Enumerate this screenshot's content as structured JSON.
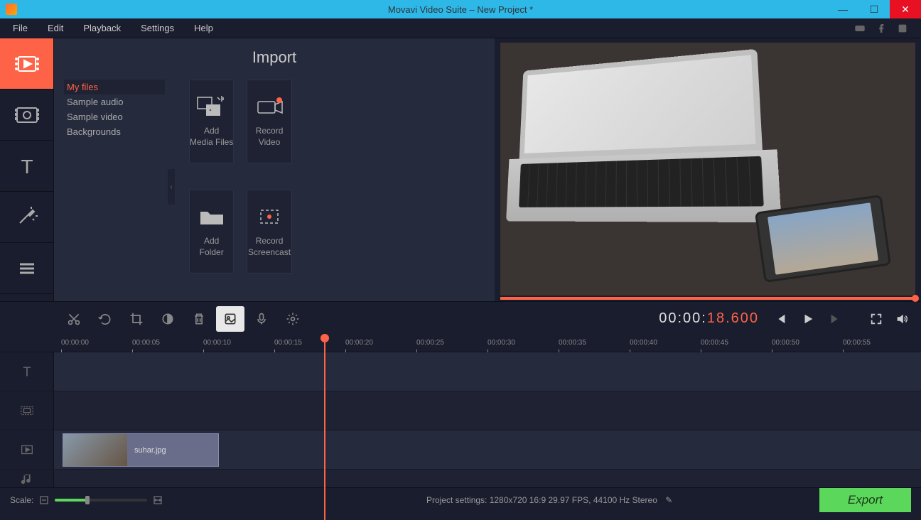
{
  "window": {
    "title": "Movavi Video Suite – New Project *"
  },
  "menu": {
    "items": [
      "File",
      "Edit",
      "Playback",
      "Settings",
      "Help"
    ]
  },
  "import": {
    "title": "Import",
    "sidebar": [
      "My files",
      "Sample audio",
      "Sample video",
      "Backgrounds"
    ],
    "tiles": [
      {
        "label": "Add\nMedia Files"
      },
      {
        "label": "Record\nVideo"
      },
      {
        "label": "Add\nFolder"
      },
      {
        "label": "Record\nScreencast"
      }
    ]
  },
  "timecode": {
    "prefix": "00:00:",
    "suffix": "18.600"
  },
  "ruler": [
    "00:00:00",
    "00:00:05",
    "00:00:10",
    "00:00:15",
    "00:00:20",
    "00:00:25",
    "00:00:30",
    "00:00:35",
    "00:00:40",
    "00:00:45",
    "00:00:50",
    "00:00:55"
  ],
  "clip": {
    "name": "suhar.jpg"
  },
  "status": {
    "scale_label": "Scale:",
    "project_settings": "Project settings:  1280x720 16:9 29.97 FPS, 44100 Hz Stereo",
    "export": "Export"
  }
}
